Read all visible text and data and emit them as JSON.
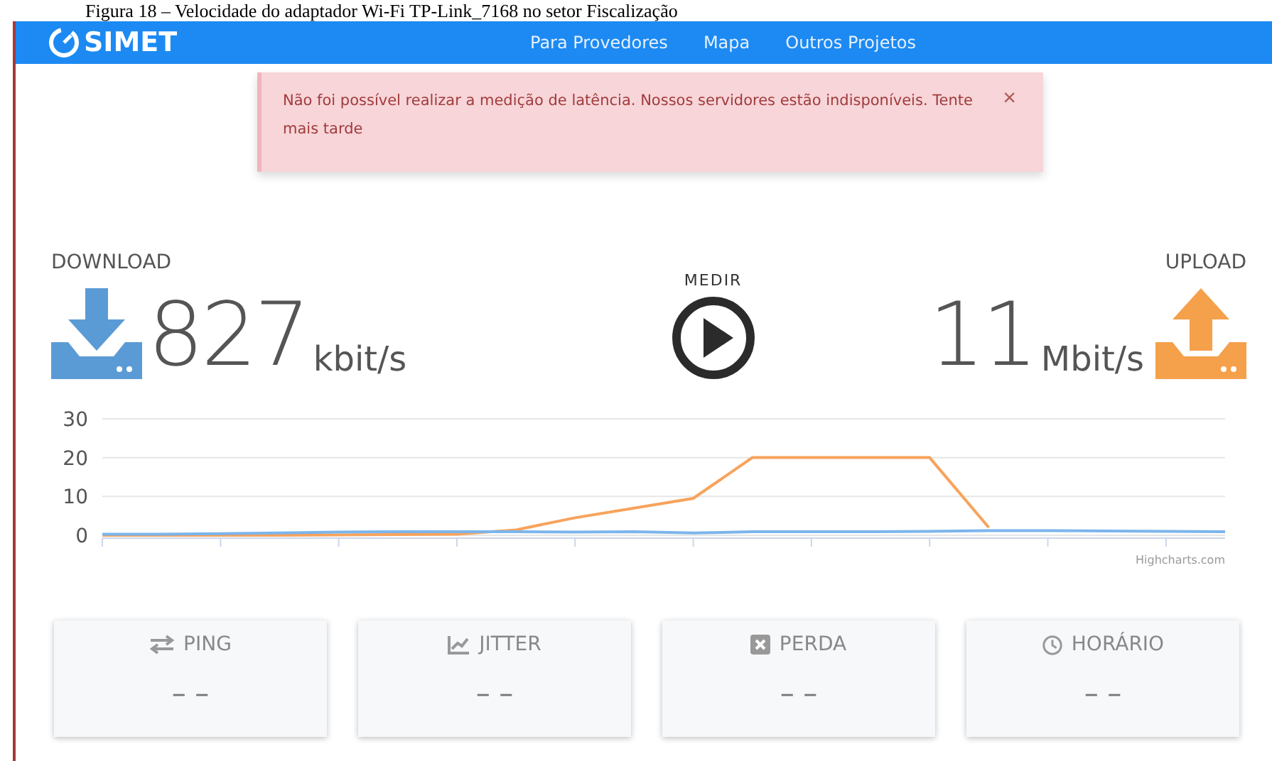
{
  "caption": "Figura 18 – Velocidade do adaptador Wi-Fi TP-Link_7168 no setor Fiscalização",
  "navbar": {
    "logo": "SIMET",
    "links": [
      "Para Provedores",
      "Mapa",
      "Outros Projetos"
    ]
  },
  "alert": {
    "message": "Não foi possível realizar a medição de latência. Nossos servidores estão indisponíveis. Tente mais tarde",
    "close": "×"
  },
  "download": {
    "label": "DOWNLOAD",
    "value": "827",
    "unit": "kbit/s"
  },
  "measure": {
    "label": "MEDIR"
  },
  "upload": {
    "label": "UPLOAD",
    "value": "11",
    "unit": "Mbit/s"
  },
  "chart": {
    "credit": "Highcharts.com",
    "chart_data": {
      "type": "line",
      "categories": [
        null,
        null,
        null,
        null,
        null,
        null,
        null,
        null,
        null,
        null,
        null,
        null,
        null,
        null,
        null,
        null,
        null,
        null,
        null,
        null
      ],
      "ylim": [
        0,
        30
      ],
      "yticks": [
        0,
        10,
        20,
        30
      ],
      "series": [
        {
          "color": "#f7a35c",
          "values": [
            0,
            0,
            0,
            0,
            0.1,
            0.2,
            0.3,
            1.4,
            4.5,
            7,
            9.5,
            20,
            20,
            20,
            20,
            2,
            null,
            null,
            null,
            null
          ]
        },
        {
          "color": "#7cb5ec",
          "values": [
            0.3,
            0.3,
            0.4,
            0.6,
            0.8,
            0.9,
            0.9,
            0.9,
            0.8,
            0.9,
            0.6,
            0.9,
            0.9,
            0.9,
            1.0,
            1.2,
            1.2,
            1.1,
            1.0,
            0.9
          ]
        }
      ]
    }
  },
  "stats": [
    {
      "kind": "ping",
      "label": "PING",
      "value": "– –"
    },
    {
      "kind": "jitter",
      "label": "JITTER",
      "value": "– –"
    },
    {
      "kind": "loss",
      "label": "PERDA",
      "value": "– –"
    },
    {
      "kind": "time",
      "label": "HORÁRIO",
      "value": "– –"
    }
  ]
}
